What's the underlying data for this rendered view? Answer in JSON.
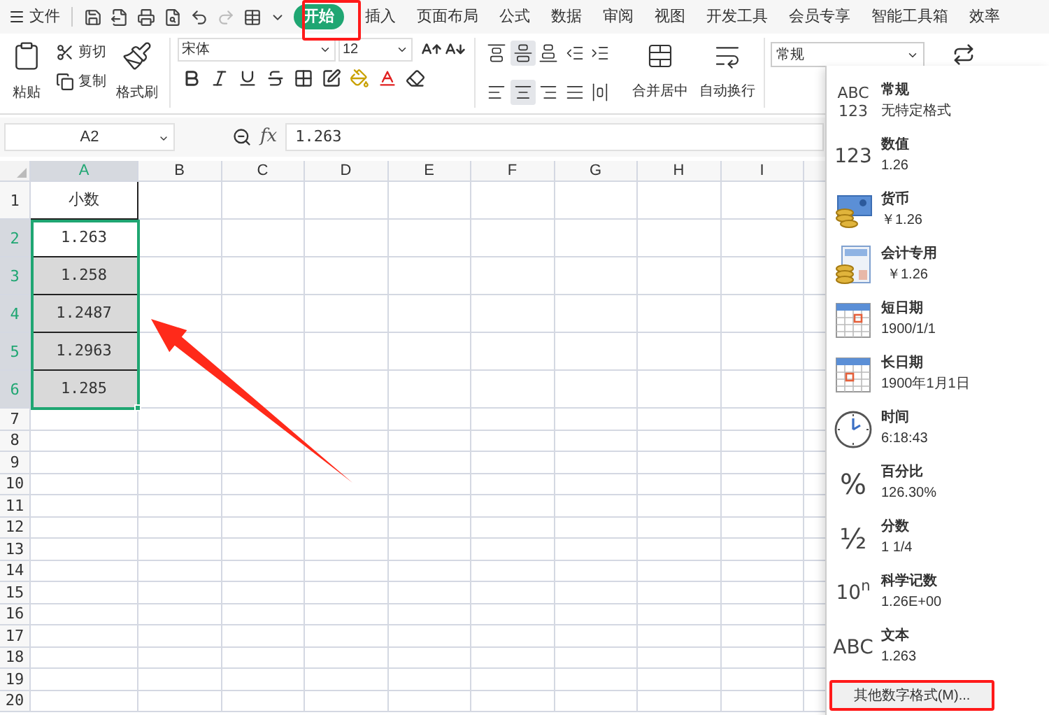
{
  "app_menu": {
    "label": "文件"
  },
  "tabs": [
    {
      "label": "开始",
      "selected": true,
      "annotated": true
    },
    {
      "label": "插入",
      "selected": false,
      "annotated": false
    },
    {
      "label": "页面布局",
      "selected": false,
      "annotated": false
    },
    {
      "label": "公式",
      "selected": false,
      "annotated": false
    },
    {
      "label": "数据",
      "selected": false,
      "annotated": false
    },
    {
      "label": "审阅",
      "selected": false,
      "annotated": false
    },
    {
      "label": "视图",
      "selected": false,
      "annotated": false
    },
    {
      "label": "开发工具",
      "selected": false,
      "annotated": false
    },
    {
      "label": "会员专享",
      "selected": false,
      "annotated": false
    },
    {
      "label": "智能工具箱",
      "selected": false,
      "annotated": false
    },
    {
      "label": "效率",
      "selected": false,
      "annotated": false
    }
  ],
  "ribbon": {
    "paste": "粘贴",
    "cut": "剪切",
    "copy": "复制",
    "format_painter": "格式刷",
    "font": "宋体",
    "font_size": "12",
    "merge": "合并居中",
    "wrap": "自动换行",
    "number_format": "常规",
    "align_buttons": [
      {
        "kind": "top",
        "selected": false
      },
      {
        "kind": "middle",
        "selected": true
      },
      {
        "kind": "bottom",
        "selected": false
      },
      {
        "kind": "outdent",
        "selected": false
      },
      {
        "kind": "indent",
        "selected": false
      },
      {
        "kind": "left",
        "selected": false
      },
      {
        "kind": "center",
        "selected": true
      },
      {
        "kind": "right",
        "selected": false
      },
      {
        "kind": "justify",
        "selected": false
      },
      {
        "kind": "distributed",
        "selected": false
      }
    ]
  },
  "formula_bar": {
    "name_box": "A2",
    "fx": "fx",
    "value": "1.263"
  },
  "sheet": {
    "columns": [
      {
        "label": "A",
        "selected": true
      },
      {
        "label": "B",
        "selected": false
      },
      {
        "label": "C",
        "selected": false
      },
      {
        "label": "D",
        "selected": false
      },
      {
        "label": "E",
        "selected": false
      },
      {
        "label": "F",
        "selected": false
      },
      {
        "label": "G",
        "selected": false
      },
      {
        "label": "H",
        "selected": false
      },
      {
        "label": "I",
        "selected": false
      }
    ],
    "rows": [
      {
        "label": "1",
        "selected": false,
        "cell": {
          "text": "小数",
          "shaded": false
        }
      },
      {
        "label": "2",
        "selected": true,
        "cell": {
          "text": "1.263",
          "shaded": false
        }
      },
      {
        "label": "3",
        "selected": true,
        "cell": {
          "text": "1.258",
          "shaded": true
        }
      },
      {
        "label": "4",
        "selected": true,
        "cell": {
          "text": "1.2487",
          "shaded": true
        }
      },
      {
        "label": "5",
        "selected": true,
        "cell": {
          "text": "1.2963",
          "shaded": true
        }
      },
      {
        "label": "6",
        "selected": true,
        "cell": {
          "text": "1.285",
          "shaded": true
        }
      },
      {
        "label": "7",
        "selected": false
      },
      {
        "label": "8",
        "selected": false
      },
      {
        "label": "9",
        "selected": false
      },
      {
        "label": "10",
        "selected": false
      },
      {
        "label": "11",
        "selected": false
      },
      {
        "label": "12",
        "selected": false
      },
      {
        "label": "13",
        "selected": false
      },
      {
        "label": "14",
        "selected": false
      },
      {
        "label": "15",
        "selected": false
      },
      {
        "label": "16",
        "selected": false
      },
      {
        "label": "17",
        "selected": false
      },
      {
        "label": "18",
        "selected": false
      },
      {
        "label": "19",
        "selected": false
      },
      {
        "label": "20",
        "selected": false
      }
    ],
    "annotation_arrow": true
  },
  "number_formats": {
    "items": [
      {
        "kind": "glyph",
        "glyph": [
          "ABC",
          "123"
        ],
        "name": "常规",
        "example": "无特定格式"
      },
      {
        "kind": "glyph",
        "glyph": [
          "123"
        ],
        "name": "数值",
        "example": "1.26"
      },
      {
        "kind": "currency",
        "name": "货币",
        "example": "￥1.26"
      },
      {
        "kind": "accounting",
        "name": "会计专用",
        "example": "￥1.26"
      },
      {
        "kind": "short_date",
        "name": "短日期",
        "example": "1900/1/1"
      },
      {
        "kind": "long_date",
        "name": "长日期",
        "example": "1900年1月1日"
      },
      {
        "kind": "time",
        "name": "时间",
        "example": "6:18:43"
      },
      {
        "kind": "glyph",
        "glyph": [
          "%"
        ],
        "name": "百分比",
        "example": "126.30%"
      },
      {
        "kind": "glyph",
        "glyph": [
          "½"
        ],
        "name": "分数",
        "example": "1 1/4"
      },
      {
        "kind": "glyph",
        "glyph": [
          "10$^{n}$"
        ],
        "name": "科学记数",
        "example": "1.26E+00"
      },
      {
        "kind": "glyph",
        "glyph": [
          "ABC"
        ],
        "name": "文本",
        "example": "1.263"
      }
    ],
    "more_button": {
      "label": "其他数字格式(M)...",
      "annotated": true
    }
  }
}
